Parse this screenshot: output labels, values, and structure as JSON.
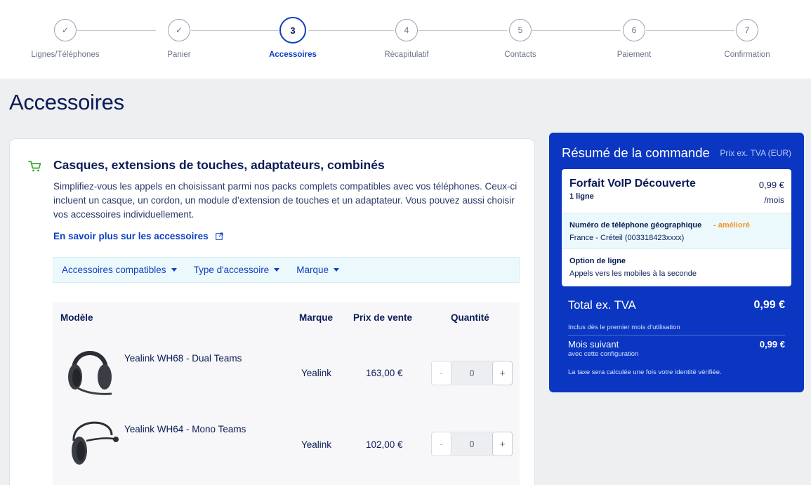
{
  "stepper": {
    "steps": [
      {
        "label": "Lignes/Téléphones",
        "state": "done",
        "symbol": "✓"
      },
      {
        "label": "Panier",
        "state": "done",
        "symbol": "✓"
      },
      {
        "label": "Accessoires",
        "state": "active",
        "symbol": "3"
      },
      {
        "label": "Récapitulatif",
        "state": "pending",
        "symbol": "4"
      },
      {
        "label": "Contacts",
        "state": "pending",
        "symbol": "5"
      },
      {
        "label": "Paiement",
        "state": "pending",
        "symbol": "6"
      },
      {
        "label": "Confirmation",
        "state": "pending",
        "symbol": "7"
      }
    ]
  },
  "page": {
    "title": "Accessoires"
  },
  "section": {
    "title": "Casques, extensions de touches, adaptateurs, combinés",
    "description": "Simplifiez-vous les appels en choisissant parmi nos packs complets compatibles avec vos téléphones. Ceux-ci incluent un casque, un cordon, un module d’extension de touches et un adaptateur. Vous pouvez aussi choisir vos accessoires individuellement.",
    "learn_more": "En savoir plus sur les accessoires"
  },
  "filters": [
    "Accessoires compatibles",
    "Type d'accessoire",
    "Marque"
  ],
  "table": {
    "headers": {
      "model": "Modèle",
      "brand": "Marque",
      "price": "Prix de vente",
      "quantity": "Quantité"
    },
    "rows": [
      {
        "name": "Yealink WH68 - Dual Teams",
        "brand": "Yealink",
        "price": "163,00 €",
        "qty": "0",
        "minus": "-",
        "plus": "+"
      },
      {
        "name": "Yealink WH64 - Mono Teams",
        "brand": "Yealink",
        "price": "102,00 €",
        "qty": "0",
        "minus": "-",
        "plus": "+"
      }
    ]
  },
  "summary": {
    "title": "Résumé de la commande",
    "subtitle": "Prix ex. TVA (EUR)",
    "plan_name": "Forfait VoIP Découverte",
    "plan_lines": "1 ligne",
    "plan_price": "0,99 €",
    "plan_period": "/mois",
    "items": [
      {
        "label": "Numéro de téléphone géographique",
        "badge": "- amélioré",
        "value": "France - Créteil (003318423xxxx)"
      },
      {
        "label": "Option de ligne",
        "badge": "",
        "value": "Appels vers les mobiles à la seconde"
      }
    ],
    "total_label": "Total ex. TVA",
    "total_value": "0,99 €",
    "included_note": "Inclus dès le premier mois d'utilisation",
    "next_month_label": "Mois suivant",
    "next_month_sub": "avec cette configuration",
    "next_month_value": "0,99 €",
    "tax_note": "La taxe sera calculée une fois votre identité vérifiée."
  },
  "colors": {
    "brand_blue": "#0d3fc2",
    "summary_bg": "#0a36c2",
    "accent_orange": "#f0952a",
    "cart_green": "#3aa935"
  }
}
